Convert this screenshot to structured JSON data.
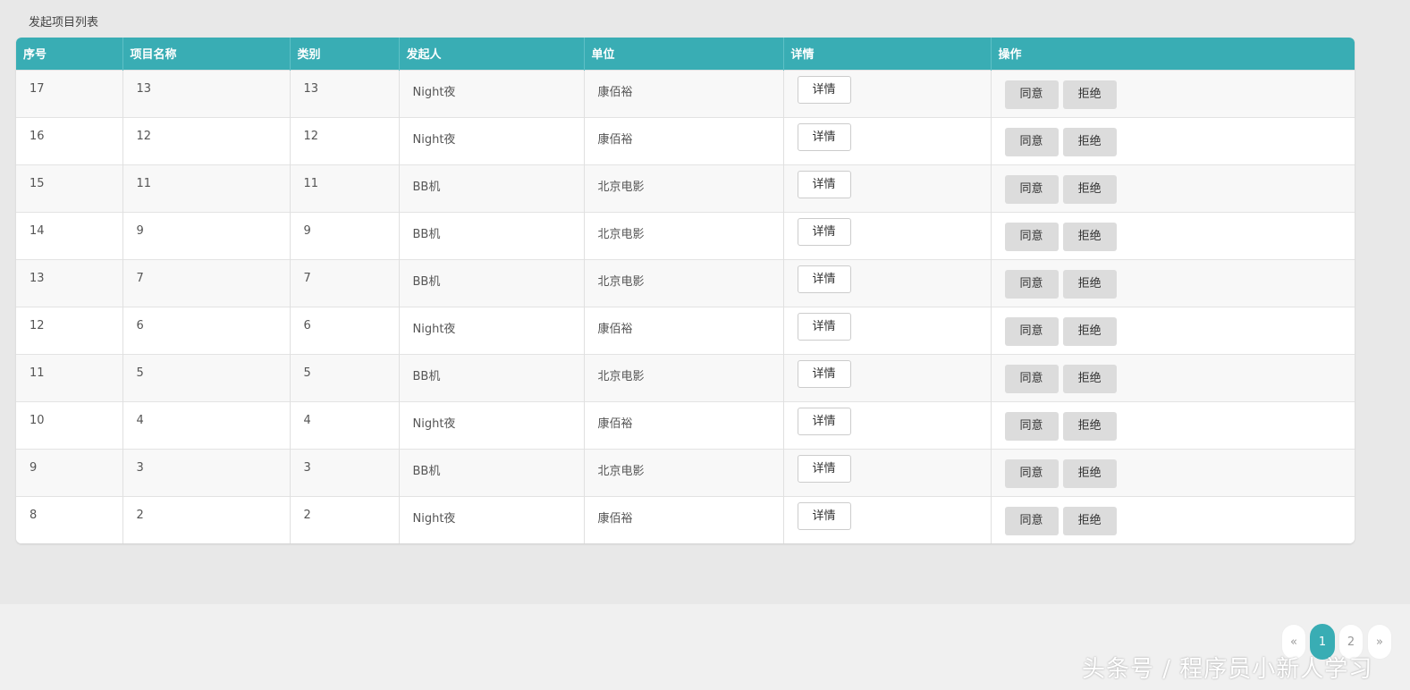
{
  "panel": {
    "title": "发起项目列表"
  },
  "table": {
    "headers": [
      "序号",
      "项目名称",
      "类别",
      "发起人",
      "单位",
      "详情",
      "操作"
    ],
    "rows": [
      [
        "17",
        "13",
        "13",
        "Night夜",
        "康佰裕"
      ],
      [
        "16",
        "12",
        "12",
        "Night夜",
        "康佰裕"
      ],
      [
        "15",
        "11",
        "11",
        "BB机",
        "北京电影"
      ],
      [
        "14",
        "9",
        "9",
        "BB机",
        "北京电影"
      ],
      [
        "13",
        "7",
        "7",
        "BB机",
        "北京电影"
      ],
      [
        "12",
        "6",
        "6",
        "Night夜",
        "康佰裕"
      ],
      [
        "11",
        "5",
        "5",
        "BB机",
        "北京电影"
      ],
      [
        "10",
        "4",
        "4",
        "Night夜",
        "康佰裕"
      ],
      [
        "9",
        "3",
        "3",
        "BB机",
        "北京电影"
      ],
      [
        "8",
        "2",
        "2",
        "Night夜",
        "康佰裕"
      ]
    ],
    "detail_label": "详情",
    "agree_label": "同意",
    "reject_label": "拒绝"
  },
  "pagination": {
    "prev": "«",
    "pages": [
      "1",
      "2"
    ],
    "active": "1",
    "next": "»"
  },
  "watermark": "头条号 / 程序员小新人学习",
  "colors": {
    "accent": "#39adb4",
    "button_gray": "#dcdcdc"
  }
}
